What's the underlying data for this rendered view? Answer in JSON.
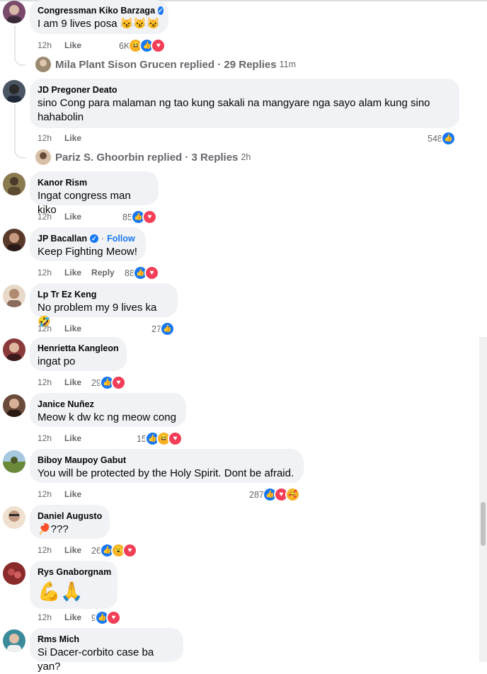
{
  "comments": [
    {
      "name": "Congressman Kiko Barzaga",
      "verified": true,
      "text": "I am 9 lives posa 😼😼😼",
      "time": "12h",
      "like": "Like",
      "reply": "",
      "count": "6K",
      "reactions": [
        "haha",
        "like",
        "heart"
      ],
      "avatar_color": "#7a4a6a"
    },
    {
      "name": "JD Pregoner Deato",
      "verified": false,
      "text": "sino Cong para malaman ng tao kung sakali na mangyare nga sayo alam kung sino hahabolin",
      "time": "12h",
      "like": "Like",
      "reply": "",
      "count": "548",
      "reactions": [
        "like"
      ],
      "avatar_color": "#4b5563"
    },
    {
      "name": "Kanor Rism",
      "verified": false,
      "text": "Ingat congress man kiko",
      "time": "12h",
      "like": "Like",
      "reply": "",
      "count": "85",
      "reactions": [
        "like",
        "heart"
      ],
      "avatar_color": "#8a7a50"
    },
    {
      "name": "JP Bacallan",
      "verified": true,
      "follow": "Follow",
      "text": "Keep Fighting Meow!",
      "time": "12h",
      "like": "Like",
      "reply": "Reply",
      "count": "88",
      "reactions": [
        "like",
        "heart"
      ],
      "avatar_color": "#5a3a2a"
    },
    {
      "name": "Lp Tr Ez Keng",
      "verified": false,
      "text": "No problem my 9 lives ka🤣",
      "time": "12h",
      "like": "Like",
      "reply": "",
      "count": "27",
      "reactions": [
        "like"
      ],
      "avatar_color": "#b08a70"
    },
    {
      "name": "Henrietta Kangleon",
      "verified": false,
      "text": "ingat po",
      "time": "12h",
      "like": "Like",
      "reply": "",
      "count": "29",
      "reactions": [
        "like",
        "heart"
      ],
      "avatar_color": "#8a3a3a"
    },
    {
      "name": "Janice Nuñez",
      "verified": false,
      "text": "Meow k dw kc ng meow cong",
      "time": "12h",
      "like": "Like",
      "reply": "",
      "count": "15",
      "reactions": [
        "like",
        "haha",
        "heart"
      ],
      "avatar_color": "#6a4a3a"
    },
    {
      "name": "Biboy Maupoy Gabut",
      "verified": false,
      "text": "You will be protected by the Holy Spirit. Dont be afraid.",
      "time": "12h",
      "like": "Like",
      "reply": "",
      "count": "287",
      "reactions": [
        "like",
        "heart",
        "care"
      ],
      "avatar_color": "#6a8a3a"
    },
    {
      "name": "Daniel Augusto",
      "verified": false,
      "text": "🏓???",
      "time": "12h",
      "like": "Like",
      "reply": "",
      "count": "26",
      "reactions": [
        "like",
        "wow",
        "heart"
      ],
      "avatar_color": "#c09a80"
    },
    {
      "name": "Rys Gnaborgnam",
      "verified": false,
      "text": "💪🙏",
      "time": "12h",
      "like": "Like",
      "reply": "",
      "count": "9",
      "reactions": [
        "like",
        "heart"
      ],
      "avatar_color": "#8a2a2a"
    },
    {
      "name": "Rms Mich",
      "verified": false,
      "text": "Si Dacer-corbito case ba yan?",
      "time": "",
      "like": "",
      "reply": "",
      "count": "",
      "reactions": [],
      "avatar_color": "#3a8a9a"
    }
  ],
  "reply_threads": [
    {
      "author": "Mila Plant Sison Grucen",
      "label": "Mila Plant Sison Grucen replied · 29 Replies",
      "time": "11m"
    },
    {
      "author": "Pariz S. Ghoorbin",
      "label": "Pariz S. Ghoorbin replied · 3 Replies",
      "time": "2h"
    }
  ],
  "icons": {
    "like": "👍",
    "heart": "♥",
    "haha": "😆",
    "wow": "😮",
    "care": "🥰"
  }
}
